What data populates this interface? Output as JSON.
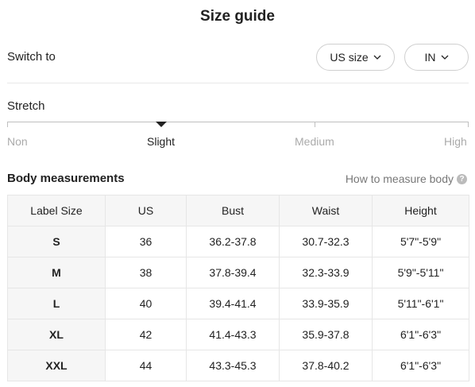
{
  "title": "Size guide",
  "switch": {
    "label": "Switch to",
    "size_value": "US size",
    "unit_value": "IN"
  },
  "stretch": {
    "title": "Stretch",
    "levels": [
      "Non",
      "Slight",
      "Medium",
      "High"
    ],
    "selected": "Slight"
  },
  "body": {
    "title": "Body measurements",
    "how_to": "How to measure body",
    "how_to_icon": "question-icon"
  },
  "table": {
    "headers": [
      "Label Size",
      "US",
      "Bust",
      "Waist",
      "Height"
    ],
    "rows": [
      [
        "S",
        "36",
        "36.2-37.8",
        "30.7-32.3",
        "5'7\"-5'9\""
      ],
      [
        "M",
        "38",
        "37.8-39.4",
        "32.3-33.9",
        "5'9\"-5'11\""
      ],
      [
        "L",
        "40",
        "39.4-41.4",
        "33.9-35.9",
        "5'11\"-6'1\""
      ],
      [
        "XL",
        "42",
        "41.4-43.3",
        "35.9-37.8",
        "6'1\"-6'3\""
      ],
      [
        "XXL",
        "44",
        "43.3-45.3",
        "37.8-40.2",
        "6'1\"-6'3\""
      ]
    ]
  },
  "colors": {
    "text": "#222222",
    "muted": "#aaaaaa",
    "header_bg": "#f6f6f6",
    "border": "#e6e6e6"
  }
}
